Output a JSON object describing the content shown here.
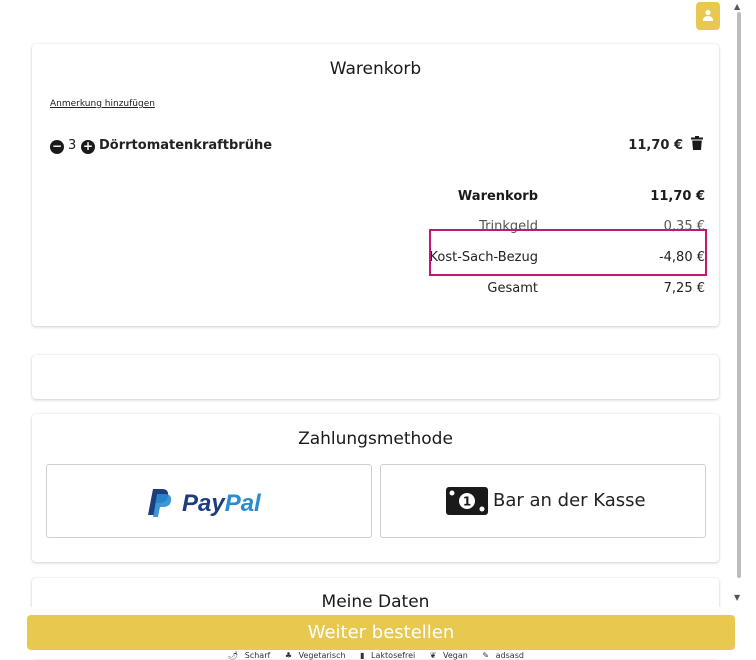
{
  "cart": {
    "title": "Warenkorb",
    "note_link": "Anmerkung hinzufügen",
    "item": {
      "minus": "−",
      "qty": "3",
      "plus": "+",
      "name": "Dörrtomatenkraftbrühe",
      "price": "11,70 €"
    },
    "summary": [
      {
        "label": "Warenkorb",
        "value": "11,70 €"
      },
      {
        "label": "Trinkgeld",
        "value": "0,35 €"
      },
      {
        "label": "Kost-Sach-Bezug",
        "value": "-4,80 €"
      },
      {
        "label": "Gesamt",
        "value": "7,25 €"
      }
    ]
  },
  "payment": {
    "title": "Zahlungsmethode",
    "paypal_part1": "Pay",
    "paypal_part2": "Pal",
    "cash_label": "Bar an der Kasse"
  },
  "personal": {
    "title": "Meine Daten"
  },
  "footer": {
    "order_button": "Weiter bestellen",
    "legend": [
      {
        "icon": "pepper-icon",
        "label": "Scharf"
      },
      {
        "icon": "vegetarian-icon",
        "label": "Vegetarisch"
      },
      {
        "icon": "milk-icon",
        "label": "Laktosefrei"
      },
      {
        "icon": "vegan-icon",
        "label": "Vegan"
      },
      {
        "icon": "tag-icon",
        "label": "adsasd"
      }
    ]
  },
  "colors": {
    "accent": "#e8c84f",
    "highlight": "#c21874",
    "paypal_dark": "#1d3d7c",
    "paypal_light": "#2a8bd0"
  }
}
